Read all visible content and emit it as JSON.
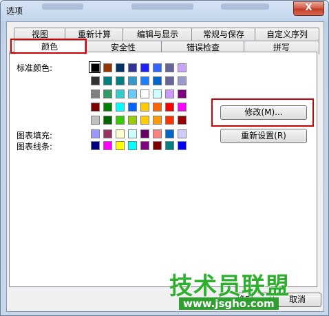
{
  "window": {
    "title": "选项",
    "close_glyph": "X"
  },
  "tabs_row1": [
    {
      "label": "视图"
    },
    {
      "label": "重新计算"
    },
    {
      "label": "编辑与显示"
    },
    {
      "label": "常规与保存"
    },
    {
      "label": "自定义序列"
    }
  ],
  "tabs_row2": [
    {
      "label": "颜色",
      "active": true
    },
    {
      "label": "安全性"
    },
    {
      "label": "错误检查"
    },
    {
      "label": "拼写"
    }
  ],
  "colors_panel": {
    "standard_label": "标准颜色:",
    "chart_fill_label": "图表填充:",
    "chart_line_label": "图表线条:",
    "standard_colors": [
      [
        "#000000",
        "#993300",
        "#003366",
        "#333399",
        "#1F1FFF",
        "#3366FF",
        "#666699",
        "#C8A2FF"
      ],
      [
        "#333333",
        "#008080",
        "#008080",
        "#3399CC",
        "#1F7FFF",
        "#0066CC",
        "#666699",
        "#9999CC"
      ],
      [
        "#808080",
        "#339966",
        "#33CCCC",
        "#66CCFF",
        "#FFFFFF",
        "#CCFFFF",
        "#CC99FF",
        "#800080"
      ],
      [
        "#800000",
        "#008000",
        "#00FFFF",
        "#0066FF",
        "#FFCC00",
        "#FF6600",
        "#FF0000",
        "#FF00FF"
      ],
      [
        "#C0C0C0",
        "#006600",
        "#33CC00",
        "#99CC00",
        "#FFCC00",
        "#FF9900",
        "#FF3300",
        "#990000"
      ]
    ],
    "chart_fill_colors": [
      "#9999FF",
      "#993366",
      "#FFFFCC",
      "#CCFFFF",
      "#660066",
      "#FF8080",
      "#0066CC",
      "#CCCCFF"
    ],
    "chart_line_colors": [
      "#000080",
      "#FF00FF",
      "#FFFF00",
      "#00FFFF",
      "#800080",
      "#800000",
      "#008080",
      "#0000FF"
    ],
    "modify_button": "修改(M)...",
    "reset_button": "重新设置(R)"
  },
  "footer": {
    "ok_button": "确定",
    "cancel_button": "取消"
  },
  "watermark": {
    "title": "技术员联盟",
    "url": "www.jsgho.com"
  },
  "accent_colors": {
    "annotation_red": "#D10000",
    "watermark_green": "#2DB02D"
  }
}
